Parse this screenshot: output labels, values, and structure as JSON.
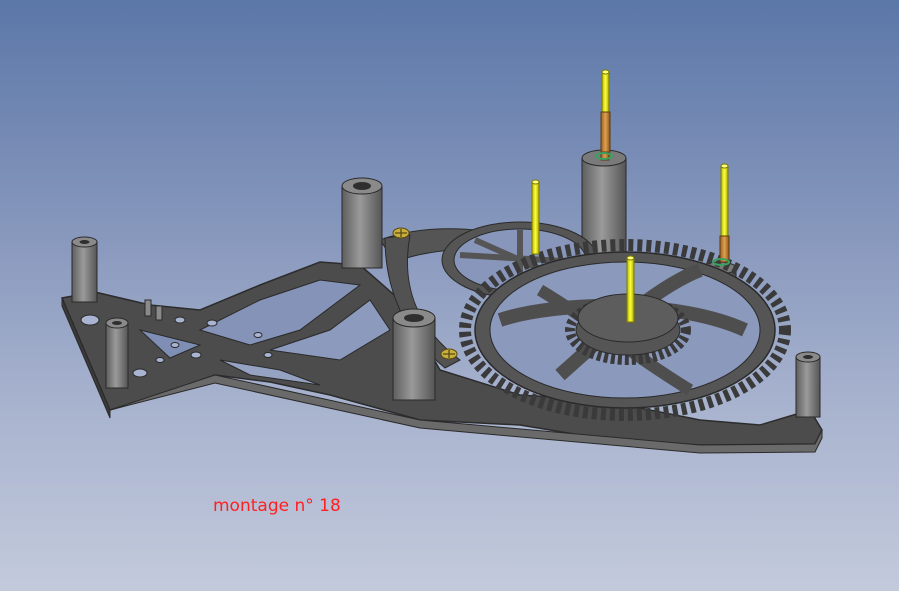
{
  "viewport": {
    "caption": "montage n° 18",
    "caption_color": "#ff2020",
    "background_top": "#5b77a8",
    "background_bottom": "#c3cadc"
  },
  "model": {
    "plate_color": "#4a4a4a",
    "plate_edge_color": "#7a7a7a",
    "pillar_color": "#6e6e6e",
    "arbor_color": "#e8e800",
    "bushing_color": "#c8893a",
    "jewel_color": "#3aa060",
    "screw_color": "#b8a030"
  }
}
